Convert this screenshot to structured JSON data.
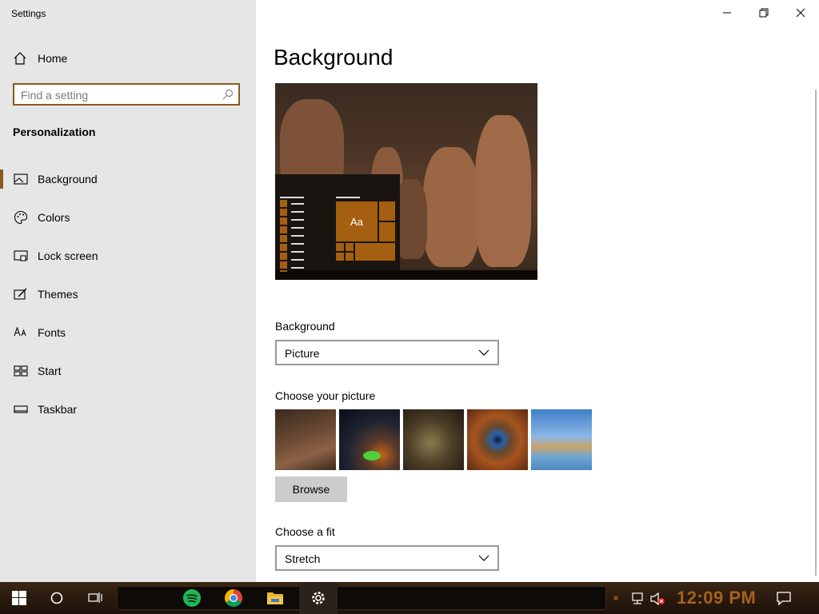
{
  "window": {
    "app_title": "Settings",
    "controls": [
      "minimize",
      "restore",
      "close"
    ]
  },
  "sidebar": {
    "home_label": "Home",
    "search_placeholder": "Find a setting",
    "section_title": "Personalization",
    "items": [
      {
        "label": "Background",
        "icon": "picture-icon",
        "active": true
      },
      {
        "label": "Colors",
        "icon": "palette-icon",
        "active": false
      },
      {
        "label": "Lock screen",
        "icon": "lock-screen-icon",
        "active": false
      },
      {
        "label": "Themes",
        "icon": "brush-icon",
        "active": false
      },
      {
        "label": "Fonts",
        "icon": "font-icon",
        "active": false
      },
      {
        "label": "Start",
        "icon": "start-menu-icon",
        "active": false
      },
      {
        "label": "Taskbar",
        "icon": "taskbar-icon",
        "active": false
      }
    ]
  },
  "main": {
    "title": "Background",
    "preview": {
      "tile_text": "Aa"
    },
    "background_label": "Background",
    "background_value": "Picture",
    "choose_picture_label": "Choose your picture",
    "browse_label": "Browse",
    "choose_fit_label": "Choose a fit",
    "fit_value": "Stretch"
  },
  "taskbar": {
    "clock": "12:09 PM",
    "apps": [
      "start-button",
      "cortana",
      "task-view",
      "spotify",
      "chrome",
      "file-explorer",
      "settings"
    ]
  },
  "colors": {
    "accent": "#a45f10",
    "focus_border": "#8a5a1c",
    "sidebar_bg": "#e6e6e6",
    "clock": "#a5611c"
  }
}
